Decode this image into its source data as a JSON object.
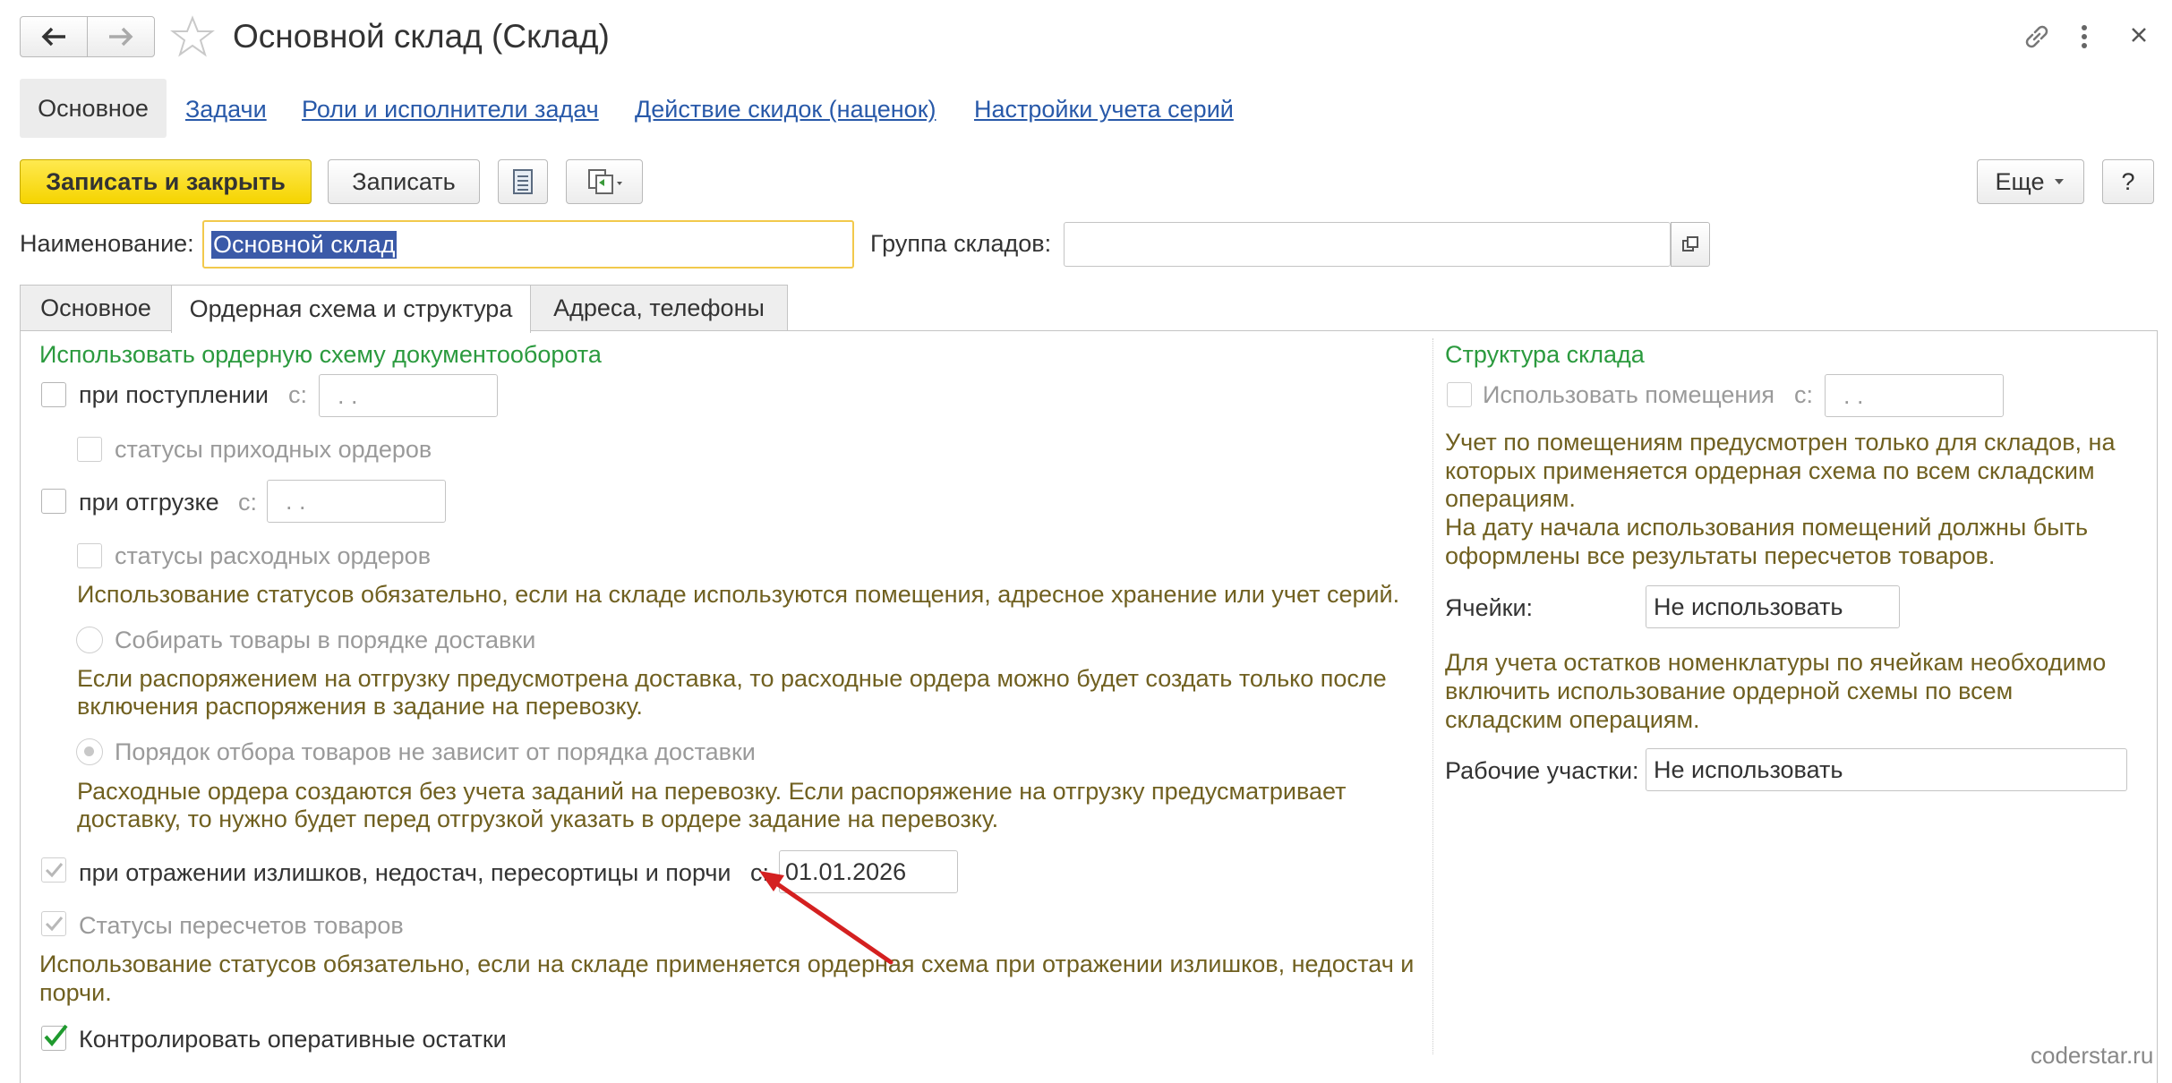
{
  "window": {
    "title": "Основной склад (Склад)",
    "back_icon": "arrow-left-icon",
    "forward_icon": "arrow-right-icon",
    "star_icon": "star-outline-icon",
    "link_icon": "link-icon",
    "more_icon": "more-vertical-icon",
    "close_icon": "close-icon"
  },
  "nav": {
    "items": [
      "Основное",
      "Задачи",
      "Роли и исполнители задач",
      "Действие скидок (наценок)",
      "Настройки учета серий"
    ]
  },
  "toolbar": {
    "save_close": "Записать и закрыть",
    "save": "Записать",
    "more": "Еще",
    "help": "?"
  },
  "form": {
    "name_label": "Наименование:",
    "name_value": "Основной склад",
    "group_label": "Группа складов:",
    "group_value": ""
  },
  "tabs": [
    "Основное",
    "Ордерная схема и структура",
    "Адреса, телефоны"
  ],
  "left": {
    "heading": "Использовать ордерную схему документооборота",
    "receipt_label": "при поступлении",
    "receipt_from": "с:",
    "receipt_date": ". .",
    "receipt_statuses": "статусы приходных ордеров",
    "shipment_label": "при отгрузке",
    "shipment_from": "с:",
    "shipment_date": ". .",
    "shipment_statuses": "статусы расходных ордеров",
    "statuses_note": "Использование статусов обязательно, если на складе используются помещения, адресное хранение или учет серий.",
    "radio1": "Собирать товары в порядке доставки",
    "radio1_note1": "Если распоряжением на отгрузку предусмотрена доставка, то расходные ордера можно будет создать только после",
    "radio1_note2": "включения распоряжения в задание на перевозку.",
    "radio2": "Порядок отбора товаров не зависит от порядка доставки",
    "radio2_note1": "Расходные ордера создаются без учета заданий на перевозку. Если распоряжение на отгрузку предусматривает",
    "radio2_note2": "доставку, то нужно будет перед отгрузкой указать в ордере задание на перевозку.",
    "surplus_label": "при отражении излишков, недостач, пересортицы и порчи",
    "surplus_from": "с:",
    "surplus_date": "01.01.2026",
    "recount_label": "Статусы пересчетов товаров",
    "recount_note1": "Использование статусов обязательно, если на складе применяется ордерная схема при отражении излишков, недостач и",
    "recount_note2": "порчи.",
    "control_label": "Контролировать оперативные остатки"
  },
  "right": {
    "heading": "Структура склада",
    "rooms_label": "Использовать помещения",
    "rooms_from": "с:",
    "rooms_date": ". .",
    "note1_l1": "Учет по помещениям предусмотрен только для складов, на",
    "note1_l2": "которых применяется ордерная схема по всем складским",
    "note1_l3": "операциям.",
    "note1_l4": "На дату начала использования помещений должны быть",
    "note1_l5": "оформлены все результаты пересчетов товаров.",
    "cells_label": "Ячейки:",
    "cells_value": "Не использовать",
    "note2_l1": "Для учета остатков номенклатуры по ячейкам необходимо",
    "note2_l2": "включить использование ордерной схемы по всем",
    "note2_l3": "складским операциям.",
    "work_label": "Рабочие участки:",
    "work_value": "Не использовать"
  },
  "watermark": "coderstar.ru",
  "colors": {
    "accent_yellow": "#f5d400",
    "link": "#2859a9",
    "green": "#2b9a3e",
    "hint": "#706020",
    "arrow": "#d42020"
  }
}
